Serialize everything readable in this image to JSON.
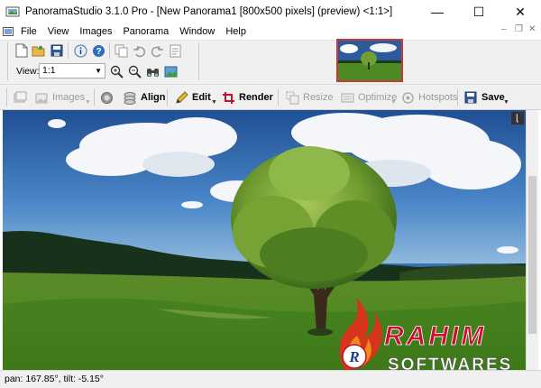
{
  "window": {
    "title": "PanoramaStudio 3.1.0 Pro - [New Panorama1 [800x500 pixels] (preview) <1:1>]",
    "minimize_glyph": "—",
    "maximize_glyph": "☐",
    "close_glyph": "✕"
  },
  "menu": {
    "items": [
      "File",
      "View",
      "Images",
      "Panorama",
      "Window",
      "Help"
    ],
    "mdi_minimize": "–",
    "mdi_restore": "❐",
    "mdi_close": "✕"
  },
  "view": {
    "label": "View:",
    "zoom_value": "1:1"
  },
  "toolbar": {
    "images": "Images",
    "align": "Align",
    "edit": "Edit",
    "render": "Render",
    "resize": "Resize",
    "optimize": "Optimize",
    "hotspots": "Hotspots",
    "save": "Save"
  },
  "status": {
    "text": "pan: 167.85°, tilt: -5.15°"
  },
  "watermark": {
    "line1": "RAHIM",
    "line2": "SOFTWARES"
  },
  "colors": {
    "accent_red": "#c8102e",
    "sky": "#3a6fb0",
    "grass": "#4e8a24"
  },
  "icons": [
    "new-file-icon",
    "open-folder-icon",
    "save-disk-icon",
    "info-icon",
    "help-icon",
    "zoom-in-icon",
    "zoom-out-icon",
    "binoculars-icon",
    "fit-image-icon"
  ]
}
